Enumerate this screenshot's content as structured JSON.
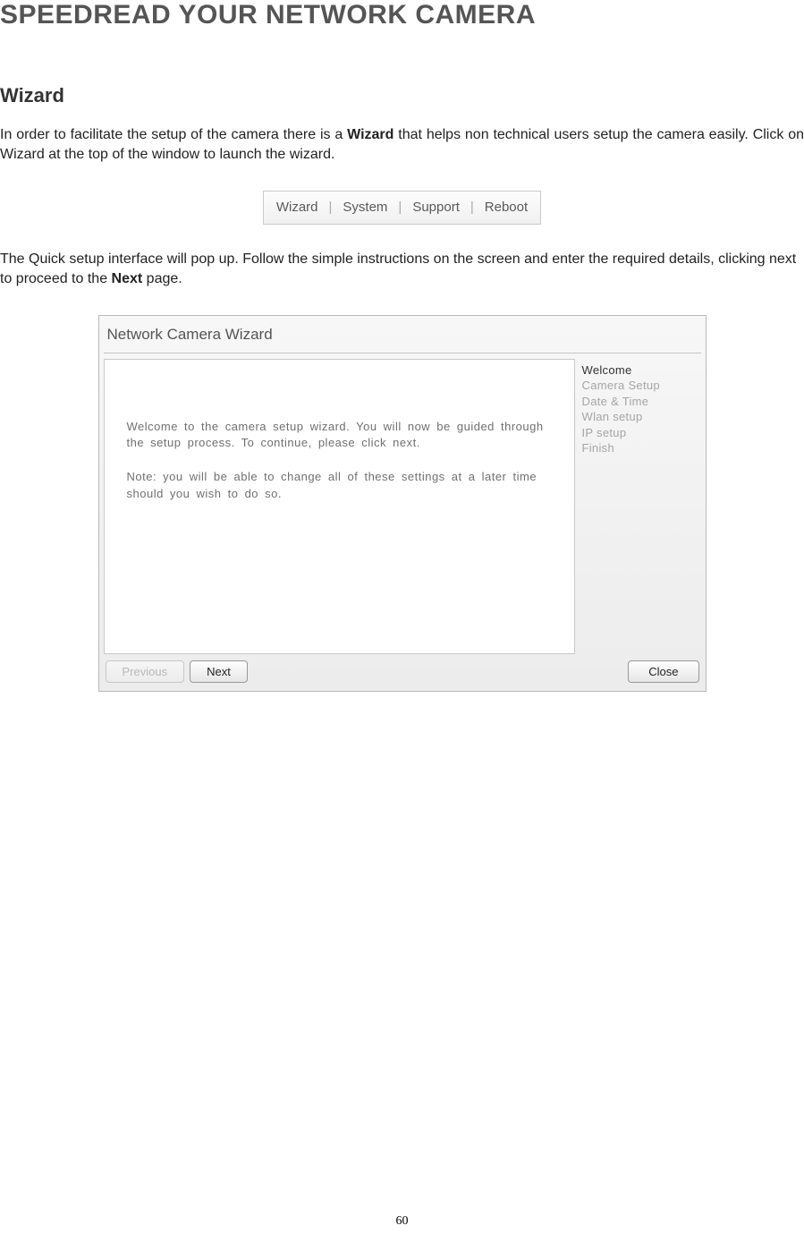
{
  "page_title": "SPEEDREAD YOUR NETWORK CAMERA",
  "section_heading": "Wizard",
  "intro_pre": "In order to facilitate the setup of the camera there is a ",
  "intro_bold": "Wizard",
  "intro_post": " that helps non technical users setup the camera easily. Click on Wizard at the top of the window to launch the wizard.",
  "nav": {
    "wizard": "Wizard",
    "system": "System",
    "support": "Support",
    "reboot": "Reboot",
    "sep": "|"
  },
  "second_para_pre": "The Quick setup interface will pop up. Follow the simple instructions on the screen and enter the required details, clicking next to proceed to the ",
  "second_para_bold": "Next",
  "second_para_post": " page.",
  "wizard": {
    "title": "Network Camera Wizard",
    "body_p1": "Welcome to the camera setup wizard. You will now be guided through the setup process. To continue, please click next.",
    "body_p2": "Note: you will be able to change all of these settings at a later time should you wish to do so.",
    "steps": {
      "welcome": "Welcome",
      "camera_setup": "Camera Setup",
      "date_time": "Date & Time",
      "wlan_setup": "Wlan setup",
      "ip_setup": "IP setup",
      "finish": "Finish"
    },
    "buttons": {
      "previous": "Previous",
      "next": "Next",
      "close": "Close"
    }
  },
  "page_number": "60"
}
